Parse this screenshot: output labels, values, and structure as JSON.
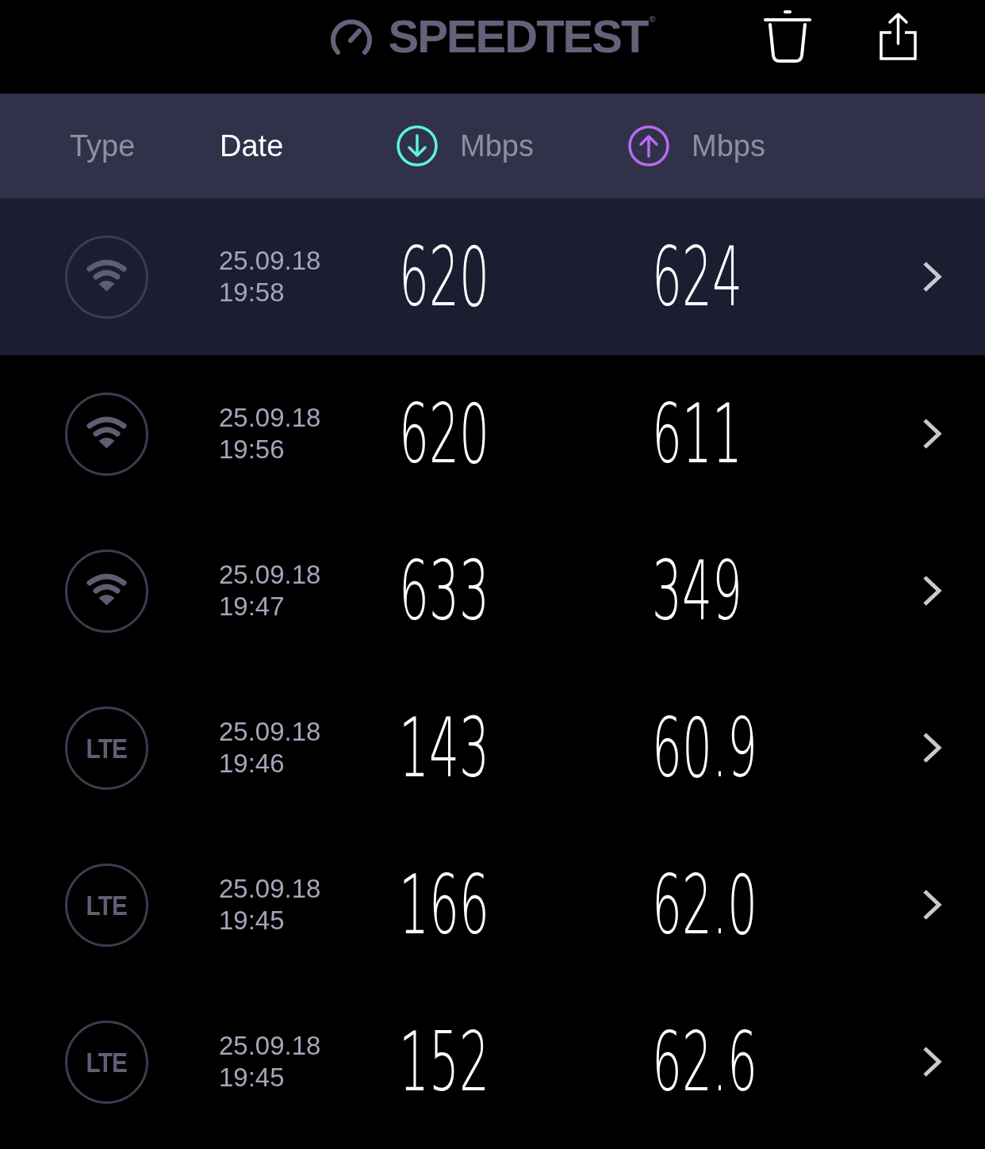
{
  "header": {
    "logo": "SPEEDTEST$^{®}$"
  },
  "columns": [
    {
      "kind": "type",
      "label": "Type",
      "selected": false
    },
    {
      "kind": "date",
      "label": "Date",
      "selected": true
    },
    {
      "kind": "download",
      "label": "Mbps",
      "selected": false,
      "color": "#5ef1e3"
    },
    {
      "kind": "upload",
      "label": "Mbps",
      "selected": false,
      "color": "#b86cf0"
    }
  ],
  "rows": [
    {
      "kind": "wifi",
      "date": "25.09.18",
      "time": "19:58",
      "download": "620",
      "upload": "624",
      "selected": true
    },
    {
      "kind": "wifi",
      "date": "25.09.18",
      "time": "19:56",
      "download": "620",
      "upload": "611",
      "selected": false
    },
    {
      "kind": "wifi",
      "date": "25.09.18",
      "time": "19:47",
      "download": "633",
      "upload": "349",
      "selected": false
    },
    {
      "kind": "lte",
      "label": "LTE",
      "date": "25.09.18",
      "time": "19:46",
      "download": "143",
      "upload": "60.9",
      "selected": false
    },
    {
      "kind": "lte",
      "label": "LTE",
      "date": "25.09.18",
      "time": "19:45",
      "download": "166",
      "upload": "62.0",
      "selected": false
    },
    {
      "kind": "lte",
      "label": "LTE",
      "date": "25.09.18",
      "time": "19:45",
      "download": "152",
      "upload": "62.6",
      "selected": false
    }
  ]
}
